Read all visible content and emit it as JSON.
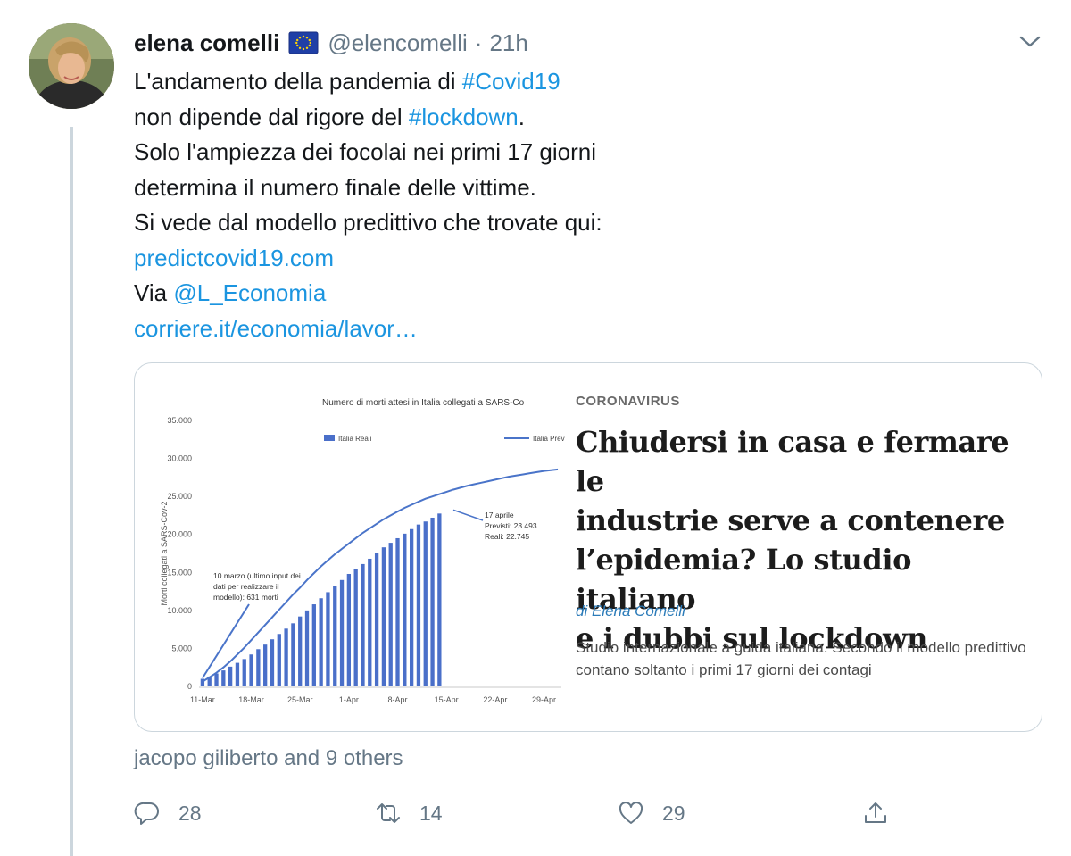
{
  "author": {
    "display_name": "elena comelli",
    "handle": "@elencomelli",
    "separator": "·",
    "time": "21h"
  },
  "tweet": {
    "lines": [
      {
        "text": "L'andamento della pandemia di ",
        "hashtag": "#Covid19"
      },
      {
        "text": "non dipende dal rigore del ",
        "hashtag": "#lockdown",
        "trail": "."
      },
      {
        "text": "Solo l'ampiezza dei focolai nei primi 17 giorni"
      },
      {
        "text": "determina il numero finale delle vittime."
      },
      {
        "text": "Si vede dal modello predittivo che trovate qui:"
      }
    ],
    "link1": "predictcovid19.com",
    "via_text": "Via ",
    "mention": "@L_Economia",
    "link2": "corriere.it/economia/lavor…"
  },
  "card": {
    "section": "CORONAVIRUS",
    "headline_lines": [
      "Chiudersi in casa e fermare le",
      "industrie serve a contenere",
      "l’epidemia? Lo studio italiano",
      "e i dubbi sul lockdown"
    ],
    "byline": "di Elena Comelli",
    "summary": "Studio internazionale a guida italiana. Secondo il modello predittivo contano soltanto i primi 17 giorni dei contagi"
  },
  "chart_data": {
    "type": "bar",
    "title": "Numero di morti attesi in Italia collegati a SARS-Co",
    "ylabel": "Morti collegati a SARS-Cov-2",
    "ylim": [
      0,
      35000
    ],
    "yticks": [
      "35.000",
      "30.000",
      "25.000",
      "20.000",
      "15.000",
      "10.000",
      "5.000",
      "0"
    ],
    "xticks": [
      "11-Mar",
      "18-Mar",
      "25-Mar",
      "1-Apr",
      "8-Apr",
      "15-Apr",
      "22-Apr",
      "29-Apr"
    ],
    "legend": [
      "Italia Reali",
      "Italia Previ"
    ],
    "annotation_left": [
      "10 marzo (ultimo input dei",
      "dati per realizzare il",
      "modello): 631 morti"
    ],
    "annotation_right": [
      "17 aprile",
      "Previsti: 23.493",
      "Reali: 22.745"
    ],
    "series": [
      {
        "name": "Italia Reali",
        "start_day": 0,
        "values": [
          1000,
          1300,
          1700,
          2100,
          2600,
          3100,
          3600,
          4200,
          4900,
          5500,
          6200,
          6900,
          7600,
          8300,
          9200,
          10000,
          10800,
          11600,
          12400,
          13200,
          14000,
          14800,
          15400,
          16100,
          16800,
          17500,
          18300,
          18900,
          19500,
          20100,
          20700,
          21300,
          21700,
          22200,
          22745
        ]
      },
      {
        "name": "Italia Previ",
        "start_day": 0,
        "values": [
          631,
          1200,
          1800,
          2500,
          3300,
          4200,
          5100,
          6100,
          7100,
          8100,
          9100,
          10100,
          11100,
          12100,
          13000,
          14000,
          14900,
          15800,
          16600,
          17400,
          18100,
          18800,
          19500,
          20200,
          20800,
          21400,
          22000,
          22500,
          23000,
          23493,
          23900,
          24300,
          24700,
          25000,
          25300,
          25600,
          25900,
          26150,
          26400,
          26600,
          26800,
          27000,
          27200,
          27400,
          27600,
          27750,
          27900,
          28050,
          28200,
          28350,
          28450,
          28550
        ]
      }
    ]
  },
  "footer": {
    "likers": "jacopo giliberto and 9 others",
    "reply_count": "28",
    "retweet_count": "14",
    "like_count": "29"
  },
  "icons": [
    "eu-flag-icon",
    "chevron-down-icon",
    "reply-icon",
    "retweet-icon",
    "like-icon",
    "share-icon"
  ],
  "colors": {
    "link": "#1b95e0",
    "muted": "#657786",
    "bars": "#4a6fc9",
    "line": "#4a74c9"
  }
}
